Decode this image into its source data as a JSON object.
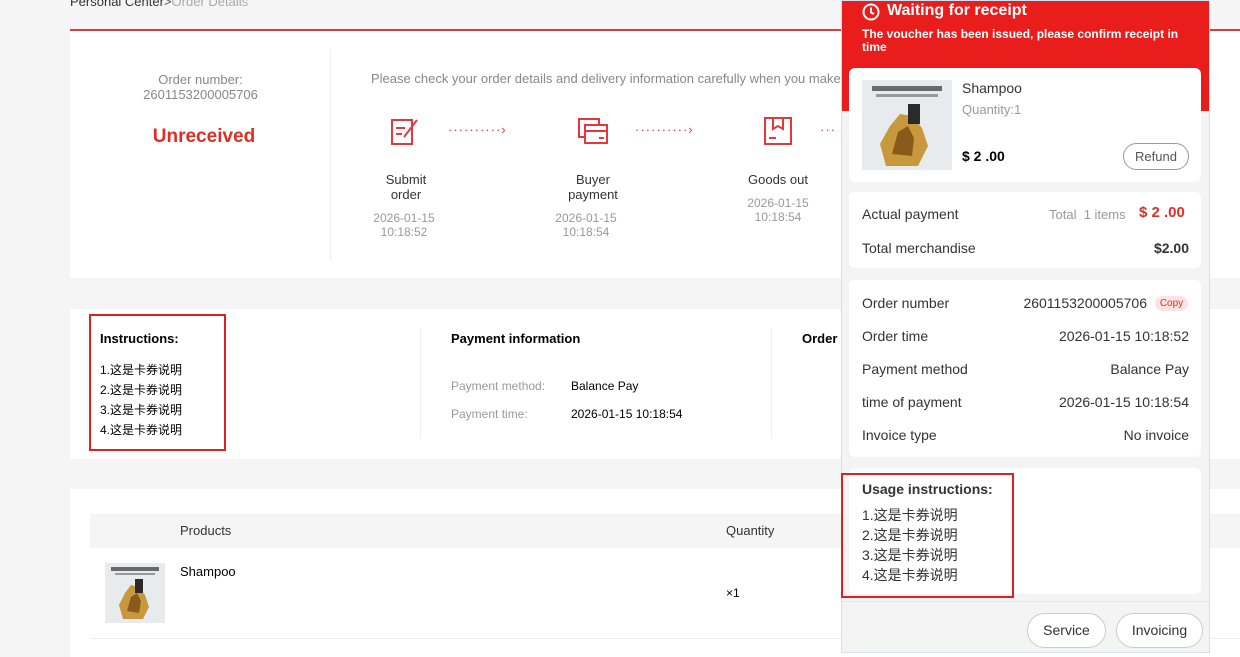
{
  "breadcrumb": {
    "home": "Personal Center",
    "sep": ">",
    "current": "Order Details"
  },
  "order_summary": {
    "label": "Order number:",
    "number": "2601153200005706",
    "status": "Unreceived",
    "hint": "Please check your order details and delivery information carefully when you make"
  },
  "steps": [
    {
      "label1": "Submit",
      "label2": "order",
      "date": "2026-01-15",
      "time": "10:18:52",
      "icon": "order-form-icon"
    },
    {
      "label1": "Buyer",
      "label2": "payment",
      "date": "2026-01-15",
      "time": "10:18:54",
      "icon": "card-payment-icon"
    },
    {
      "label1": "Goods out",
      "label2": "",
      "date": "2026-01-15",
      "time": "10:18:54",
      "icon": "package-box-icon"
    }
  ],
  "instructions": {
    "title": "Instructions:",
    "items": [
      "1.这是卡券说明",
      "2.这是卡券说明",
      "3.这是卡券说明",
      "4.这是卡券说明"
    ]
  },
  "payment_info": {
    "title": "Payment information",
    "method_label": "Payment method:",
    "method_value": "Balance Pay",
    "time_label": "Payment time:",
    "time_value": "2026-01-15 10:18:54"
  },
  "order_info": {
    "title_partial": "Order i"
  },
  "products_table": {
    "headers": {
      "products": "Products",
      "quantity": "Quantity"
    },
    "rows": [
      {
        "name": "Shampoo",
        "qty": "×1"
      }
    ]
  },
  "drawer": {
    "title": "Waiting for receipt",
    "subtitle": "The voucher has been issued, please confirm receipt in time",
    "product": {
      "name": "Shampoo",
      "quantity": "Quantity:1",
      "price": "$ 2 .00",
      "refund": "Refund"
    },
    "summary": {
      "actual_label": "Actual payment",
      "total_text": "Total",
      "items_text": "1 items",
      "actual_value": "$ 2 .00",
      "merch_label": "Total merchandise",
      "merch_value": "$2.00"
    },
    "details": {
      "order_number_label": "Order number",
      "order_number_value": "2601153200005706",
      "copy": "Copy",
      "order_time_label": "Order time",
      "order_time_value": "2026-01-15 10:18:52",
      "pay_method_label": "Payment method",
      "pay_method_value": "Balance Pay",
      "pay_time_label": "time of payment",
      "pay_time_value": "2026-01-15 10:18:54",
      "invoice_label": "Invoice type",
      "invoice_value": "No invoice"
    },
    "usage": {
      "title": "Usage instructions:",
      "items": [
        "1.这是卡券说明",
        "2.这是卡券说明",
        "3.这是卡券说明",
        "4.这是卡券说明"
      ]
    },
    "buttons": {
      "service": "Service",
      "invoicing": "Invoicing"
    }
  },
  "colors": {
    "accent_red": "#e02e24",
    "header_red": "#ea1d1d",
    "highlight_box": "#e02020"
  }
}
